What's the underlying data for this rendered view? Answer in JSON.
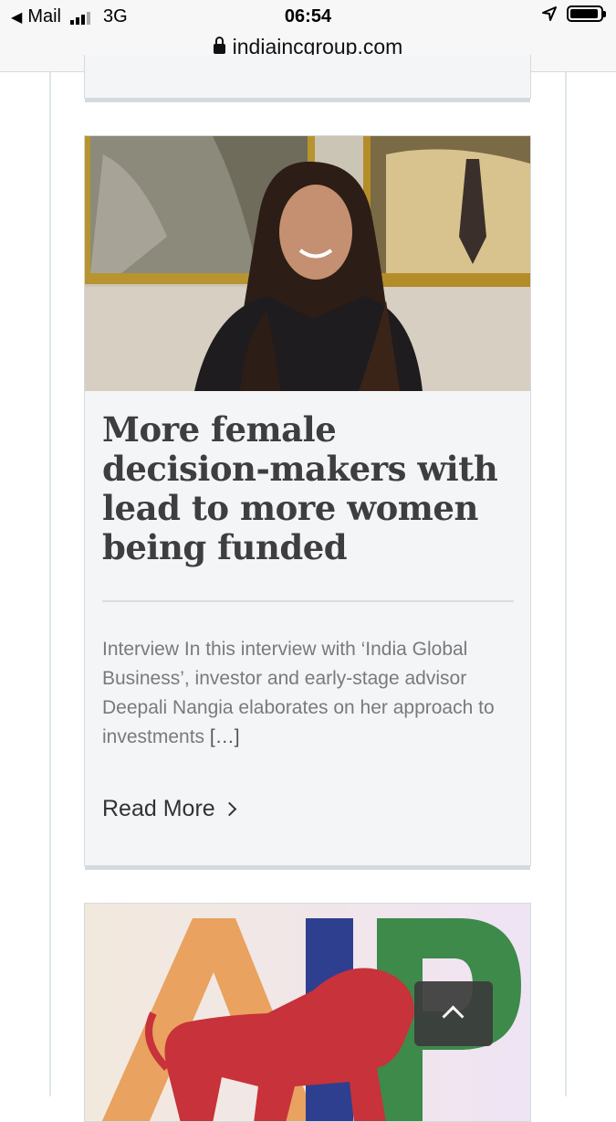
{
  "status_bar": {
    "back_app": "Mail",
    "network": "3G",
    "time": "06:54"
  },
  "browser": {
    "url": "indiaincgroup.com"
  },
  "article": {
    "title": "More female decision-makers with lead to more women being funded",
    "excerpt": "Interview In this interview with ‘India Global Business’, investor and early-stage advisor Deepali Nangia elaborates on her approach to investments",
    "excerpt_more": "[…]",
    "read_more_label": "Read More"
  },
  "next_article": {
    "logo_letters": "AIP"
  },
  "icons": {
    "back": "back-arrow-icon",
    "signal": "signal-bars-icon",
    "location": "location-arrow-icon",
    "battery": "battery-icon",
    "lock": "lock-icon",
    "chevron": "chevron-right-icon",
    "scroll_top": "chevron-up-icon"
  },
  "colors": {
    "title": "#3e3e40",
    "excerpt": "#7a7a7a",
    "card_bg": "#f4f5f7",
    "scroll_button": "#3b3b3b"
  }
}
